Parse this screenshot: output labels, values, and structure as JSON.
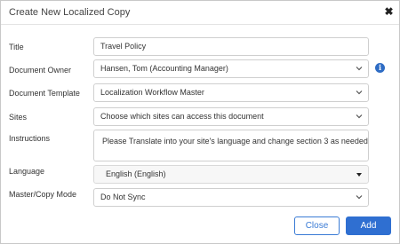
{
  "dialog": {
    "title": "Create New Localized Copy",
    "close_glyph": "✖"
  },
  "labels": {
    "title": "Title",
    "owner": "Document Owner",
    "template": "Document Template",
    "sites": "Sites",
    "instructions": "Instructions",
    "language": "Language",
    "mode": "Master/Copy Mode"
  },
  "fields": {
    "title_value": "Travel Policy",
    "owner_value": "Hansen, Tom (Accounting Manager)",
    "template_value": "Localization Workflow Master",
    "sites_placeholder": "Choose which sites can access this document",
    "instructions_value": "Please Translate into your site's language and change section 3 as needed.",
    "language_value": "English (English)",
    "mode_value": "Do Not Sync"
  },
  "icons": {
    "info": "i",
    "info_color": "#2e6cc4"
  },
  "buttons": {
    "close_label": "Close",
    "add_label": "Add",
    "accent": "#2f6fd1"
  }
}
